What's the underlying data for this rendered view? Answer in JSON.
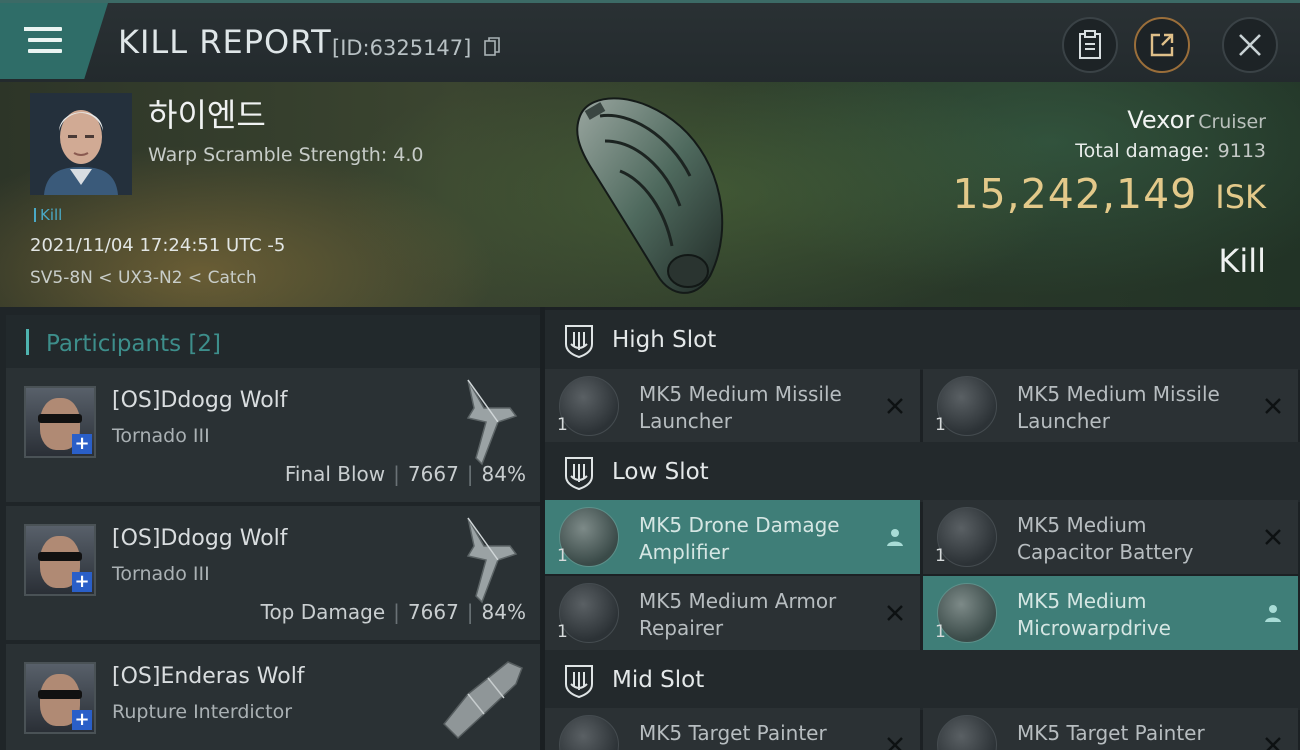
{
  "header": {
    "title": "KILL REPORT",
    "report_id": "[ID:6325147]"
  },
  "victim": {
    "name": "하이엔드",
    "warp_scramble": "Warp Scramble Strength: 4.0",
    "tag": "Kill",
    "datetime": "2021/11/04 17:24:51 UTC -5",
    "route": "SV5-8N < UX3-N2 < Catch",
    "ship_name": "Vexor",
    "ship_class": "Cruiser",
    "total_damage_label": "Total damage:",
    "total_damage": "9113",
    "isk_value": "15,242,149",
    "isk_unit": "ISK",
    "result": "Kill"
  },
  "participants": {
    "title": "Participants [2]",
    "rows": [
      {
        "name": "[OS]Ddogg Wolf",
        "ship": "Tornado III",
        "role": "Final Blow",
        "damage": "7667",
        "percent": "84%"
      },
      {
        "name": "[OS]Ddogg Wolf",
        "ship": "Tornado III",
        "role": "Top Damage",
        "damage": "7667",
        "percent": "84%"
      },
      {
        "name": "[OS]Enderas Wolf",
        "ship": "Rupture Interdictor"
      }
    ]
  },
  "slots": {
    "high": {
      "label": "High Slot",
      "items": [
        {
          "qty": "1",
          "line1": "MK5 Medium Missile",
          "line2": "Launcher",
          "status": "destroyed"
        },
        {
          "qty": "1",
          "line1": "MK5 Medium Missile",
          "line2": "Launcher",
          "status": "destroyed"
        }
      ]
    },
    "low": {
      "label": "Low Slot",
      "items": [
        {
          "qty": "1",
          "line1": "MK5 Drone Damage",
          "line2": "Amplifier",
          "status": "dropped"
        },
        {
          "qty": "1",
          "line1": "MK5 Medium",
          "line2": "Capacitor Battery",
          "status": "destroyed"
        },
        {
          "qty": "1",
          "line1": "MK5 Medium Armor",
          "line2": "Repairer",
          "status": "destroyed"
        },
        {
          "qty": "1",
          "line1": "MK5 Medium",
          "line2": "Microwarpdrive",
          "status": "dropped"
        }
      ]
    },
    "mid": {
      "label": "Mid Slot",
      "items": [
        {
          "qty": "1",
          "line1": "MK5 Target Painter",
          "status": "destroyed"
        },
        {
          "qty": "1",
          "line1": "MK5 Target Painter",
          "status": "destroyed"
        }
      ]
    }
  },
  "colors": {
    "accent": "#3f7e78",
    "isk": "#e3c98a",
    "kill_tag": "#4aa9c6"
  }
}
